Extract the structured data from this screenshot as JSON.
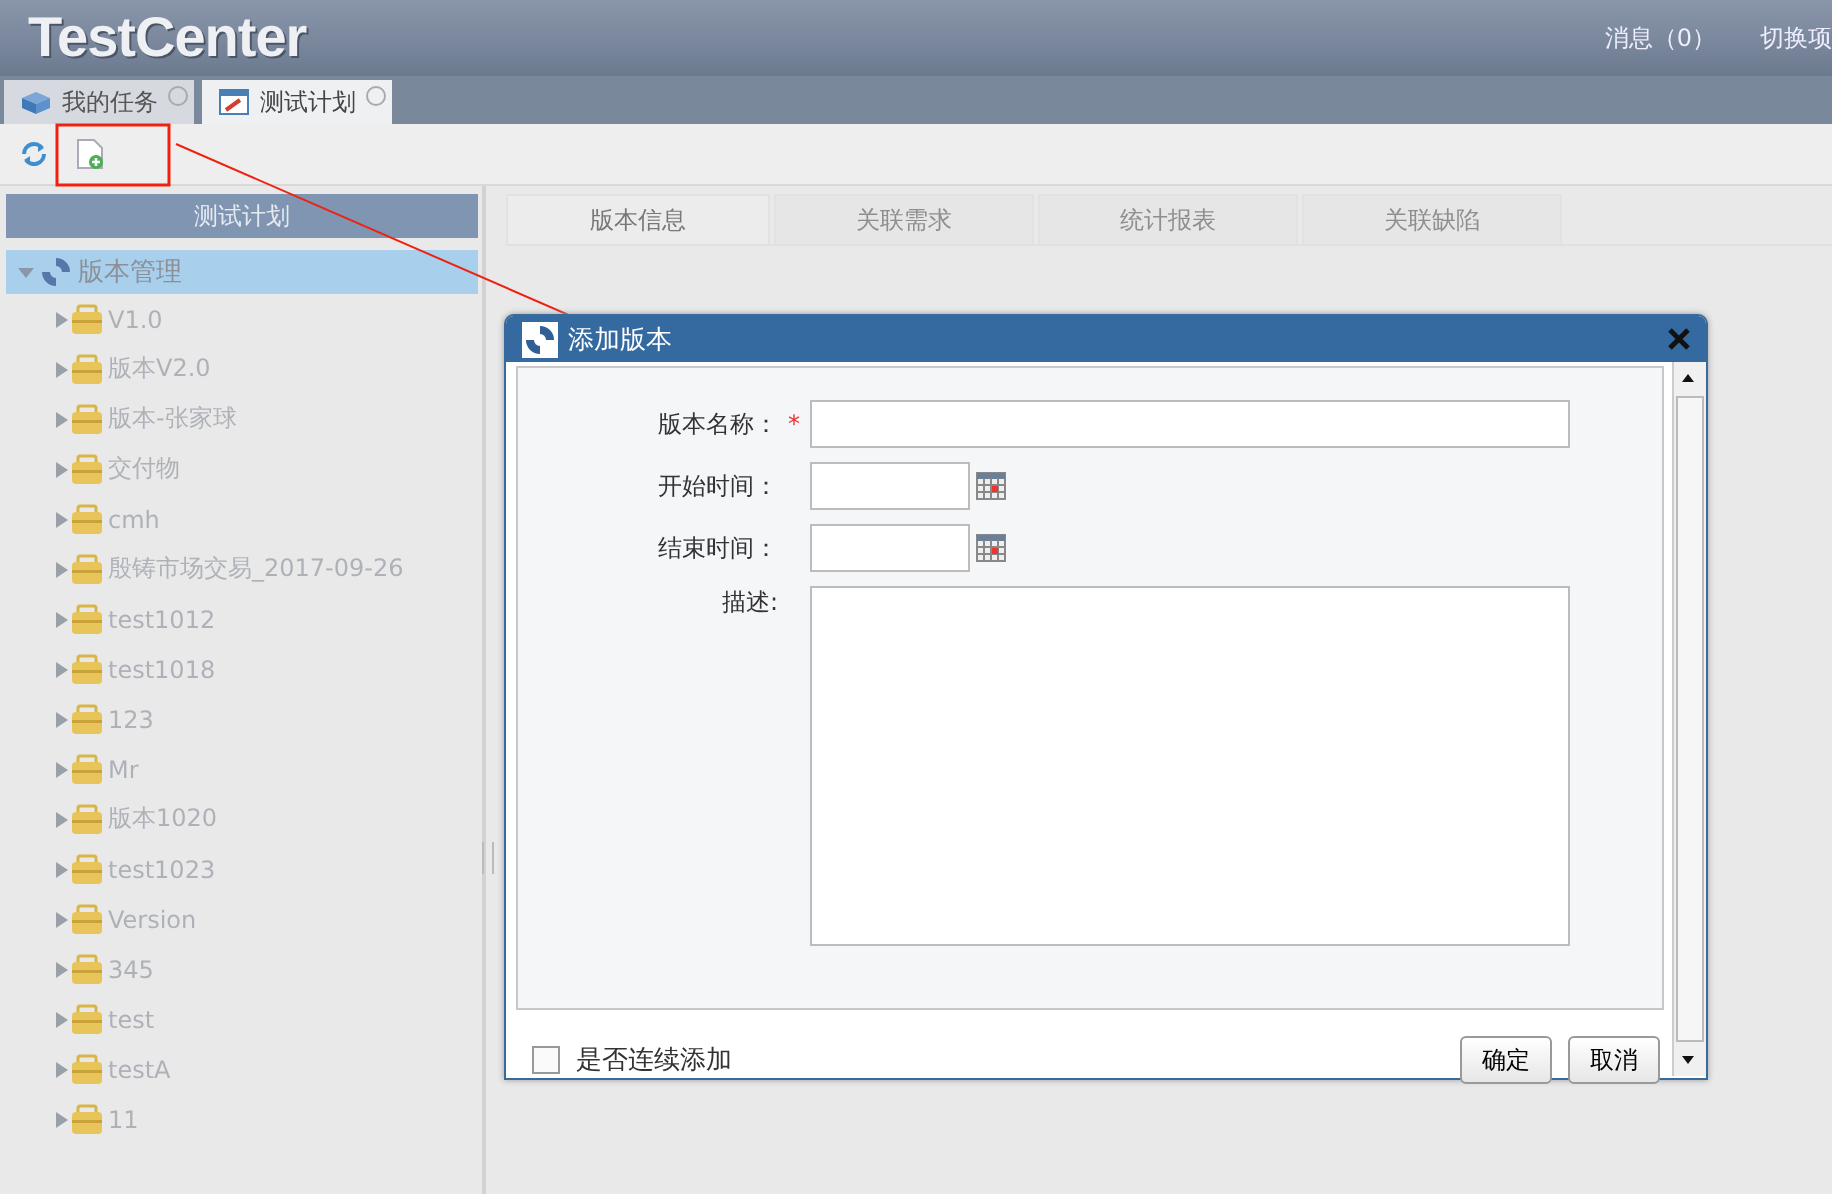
{
  "header": {
    "logo": "TestCenter",
    "links": [
      "消息（0）",
      "切换项"
    ]
  },
  "tabs": [
    {
      "label": "我的任务",
      "selected": false
    },
    {
      "label": "测试计划",
      "selected": true
    }
  ],
  "sidebar": {
    "title": "测试计划",
    "tree": {
      "label": "版本管理",
      "expanded": true,
      "selected": true,
      "children": [
        {
          "label": "V1.0"
        },
        {
          "label": "版本V2.0"
        },
        {
          "label": "版本-张家球"
        },
        {
          "label": "交付物"
        },
        {
          "label": "cmh"
        },
        {
          "label": "殷铸市场交易_2017-09-26"
        },
        {
          "label": "test1012"
        },
        {
          "label": "test1018"
        },
        {
          "label": "123"
        },
        {
          "label": "Mr"
        },
        {
          "label": "版本1020"
        },
        {
          "label": "test1023"
        },
        {
          "label": "Version"
        },
        {
          "label": "345"
        },
        {
          "label": "test"
        },
        {
          "label": "testA"
        },
        {
          "label": "11"
        }
      ]
    }
  },
  "content_tabs": [
    {
      "label": "版本信息",
      "selected": true
    },
    {
      "label": "关联需求",
      "selected": false
    },
    {
      "label": "统计报表",
      "selected": false
    },
    {
      "label": "关联缺陷",
      "selected": false
    }
  ],
  "dialog": {
    "title": "添加版本",
    "fields": [
      {
        "kind": "text",
        "label": "版本名称：",
        "required_mark": "*"
      },
      {
        "kind": "date",
        "label": "开始时间："
      },
      {
        "kind": "date",
        "label": "结束时间："
      },
      {
        "kind": "textarea",
        "label": "描述:"
      }
    ],
    "continue_add": {
      "label": "是否连续添加",
      "checked": false
    },
    "buttons": [
      "确定",
      "取消"
    ]
  }
}
